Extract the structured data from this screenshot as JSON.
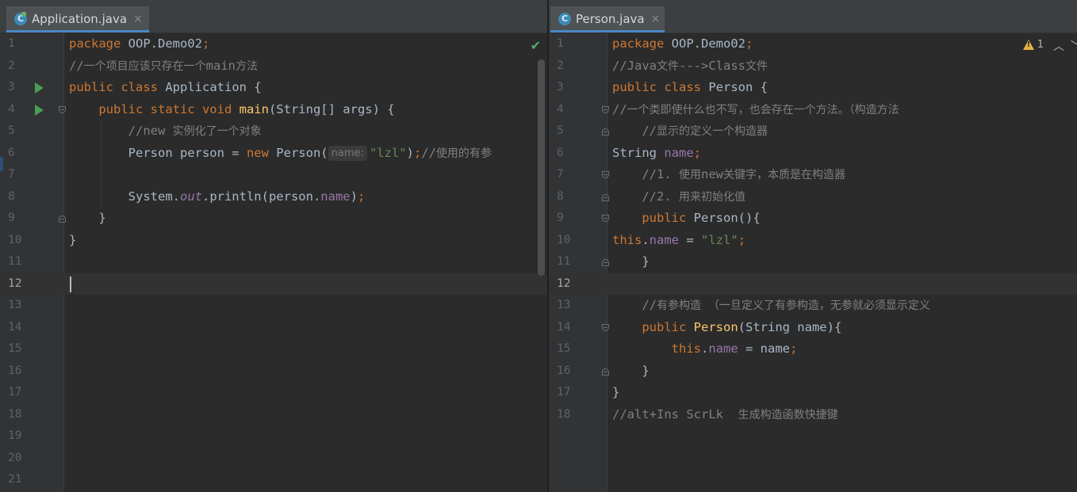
{
  "left": {
    "tab": {
      "icon": "class-icon",
      "icon_glyph": "C",
      "label": "Application.java",
      "close": "×"
    },
    "lines": [
      {
        "n": "1",
        "html": "<span class='kw'>package </span>OOP.Demo02<span class='kw'>;</span>"
      },
      {
        "n": "2",
        "html": "<span class='cmt'>//<span class='zh'>一个项目应该只存在一个</span>main<span class='zh'>方法</span></span>"
      },
      {
        "n": "3",
        "html": "<span class='kw'>public class </span>Application {"
      },
      {
        "n": "4",
        "html": "    <span class='kw'>public static void </span><span class='fn'>main</span>(String[] args) {"
      },
      {
        "n": "5",
        "html": "        <span class='cmt'>//new <span class='zh'>实例化了一个对象</span></span>"
      },
      {
        "n": "6",
        "html": "        Person person = <span class='kw'>new </span>Person(<span class='hint'>name:</span><span class='str'>\"lzl\"</span>)<span class='kw'>;</span><span class='cmt'>//<span class='zh'>使用的有参</span></span>"
      },
      {
        "n": "7",
        "html": ""
      },
      {
        "n": "8",
        "html": "        System.<span class='fld ital'>out</span>.println(person.<span class='fld'>name</span>)<span class='kw'>;</span>"
      },
      {
        "n": "9",
        "html": "    }"
      },
      {
        "n": "10",
        "html": "}"
      },
      {
        "n": "11",
        "html": ""
      },
      {
        "n": "12",
        "html": ""
      },
      {
        "n": "13",
        "html": ""
      },
      {
        "n": "14",
        "html": ""
      },
      {
        "n": "15",
        "html": ""
      },
      {
        "n": "16",
        "html": ""
      },
      {
        "n": "17",
        "html": ""
      },
      {
        "n": "18",
        "html": ""
      },
      {
        "n": "19",
        "html": ""
      },
      {
        "n": "20",
        "html": ""
      },
      {
        "n": "21",
        "html": ""
      }
    ],
    "current_line": 12
  },
  "right": {
    "tab": {
      "icon": "class-icon",
      "icon_glyph": "C",
      "label": "Person.java",
      "close": "×"
    },
    "warnings": {
      "icon": "warning-icon",
      "count": "1"
    },
    "lines": [
      {
        "n": "1",
        "html": "<span class='kw'>package </span>OOP.Demo02<span class='kw'>;</span>"
      },
      {
        "n": "2",
        "html": "<span class='cmt'>//Java<span class='zh'>文件</span>---&gt;Class<span class='zh'>文件</span></span>"
      },
      {
        "n": "3",
        "html": "<span class='kw'>public class </span>Person {"
      },
      {
        "n": "4",
        "html": "<span class='cmt'>//<span class='zh'>一个类即使什么也不写，也会存在一个方法。（构造方法</span></span>"
      },
      {
        "n": "5",
        "html": "    <span class='cmt'>//<span class='zh'>显示的定义一个构造器</span></span>"
      },
      {
        "n": "6",
        "html": "String <span class='fld'>name</span><span class='kw'>;</span>"
      },
      {
        "n": "7",
        "html": "    <span class='cmt'>//1. <span class='zh'>使用</span>new<span class='zh'>关键字，本质是在构造器</span></span>"
      },
      {
        "n": "8",
        "html": "    <span class='cmt'>//2. <span class='zh'>用来初始化值</span></span>"
      },
      {
        "n": "9",
        "html": "    <span class='kw'>public </span><span class='fn' style='color:#a9b7c6'>Person</span>(){"
      },
      {
        "n": "10",
        "html": "<span class='kw'>this</span>.<span class='fld'>name </span>= <span class='str'>\"lzl\"</span><span class='kw'>;</span>"
      },
      {
        "n": "11",
        "html": "    }"
      },
      {
        "n": "12",
        "html": ""
      },
      {
        "n": "13",
        "html": "    <span class='cmt'>//<span class='zh'>有参构造  （一旦定义了有参构造，无参就必须显示定义</span></span>"
      },
      {
        "n": "14",
        "html": "    <span class='kw'>public </span><span class='fn'>Person</span>(String name){"
      },
      {
        "n": "15",
        "html": "        <span class='kw'>this</span>.<span class='fld'>name </span>= name<span class='kw'>;</span>"
      },
      {
        "n": "16",
        "html": "    }"
      },
      {
        "n": "17",
        "html": "}"
      },
      {
        "n": "18",
        "html": "<span class='cmt'>//alt+Ins ScrLk  <span class='zh'>生成构造函数快捷键</span></span>"
      }
    ],
    "current_line": 12
  }
}
